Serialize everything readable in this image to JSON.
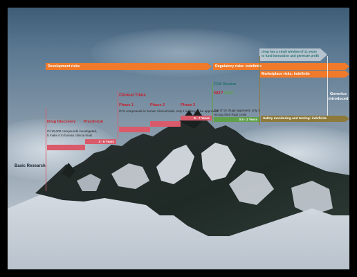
{
  "stages": {
    "basic_research": "Basic Research",
    "drug_discovery": "Drug Discovery",
    "preclinical": "Preclinical",
    "clinical_trials": "Clinical Trials",
    "phase1": "Phase 1",
    "phase2": "Phase 2",
    "phase3": "Phase 3",
    "fda_review": "FDA Review",
    "no": "NO?",
    "yes": "YES!",
    "generics": "Generics introduced"
  },
  "notes": {
    "discovery": "Of 10,000 compounds investigated, 5 make it to human clinical trials.",
    "clinical": "Of 5 compounds in human clinical trials, only 1 is likely to be approved.",
    "fda": "Out of 10 drugs approved, only 2 recoup their R&D costs",
    "window": "Drug has a small window of 11 years to fund innovation and generate profit"
  },
  "durations": {
    "preclinical": "3 - 6 Years",
    "clinical": "6 - 7 Years",
    "fda": "0.5 - 2 Years"
  },
  "risks": {
    "development": "Development risks",
    "regulatory": "Regulatory risks: indefinite",
    "marketplace": "Marketplace risks: indefinite",
    "safety": "Safety monitoring and testing: indefinite"
  },
  "colors": {
    "orange": "#f07a2a",
    "pink": "#d95a6a",
    "green": "#5fa04a",
    "olive": "#8d7a3a",
    "teal_text": "#1e6f6a",
    "red_text": "#c8202a"
  }
}
